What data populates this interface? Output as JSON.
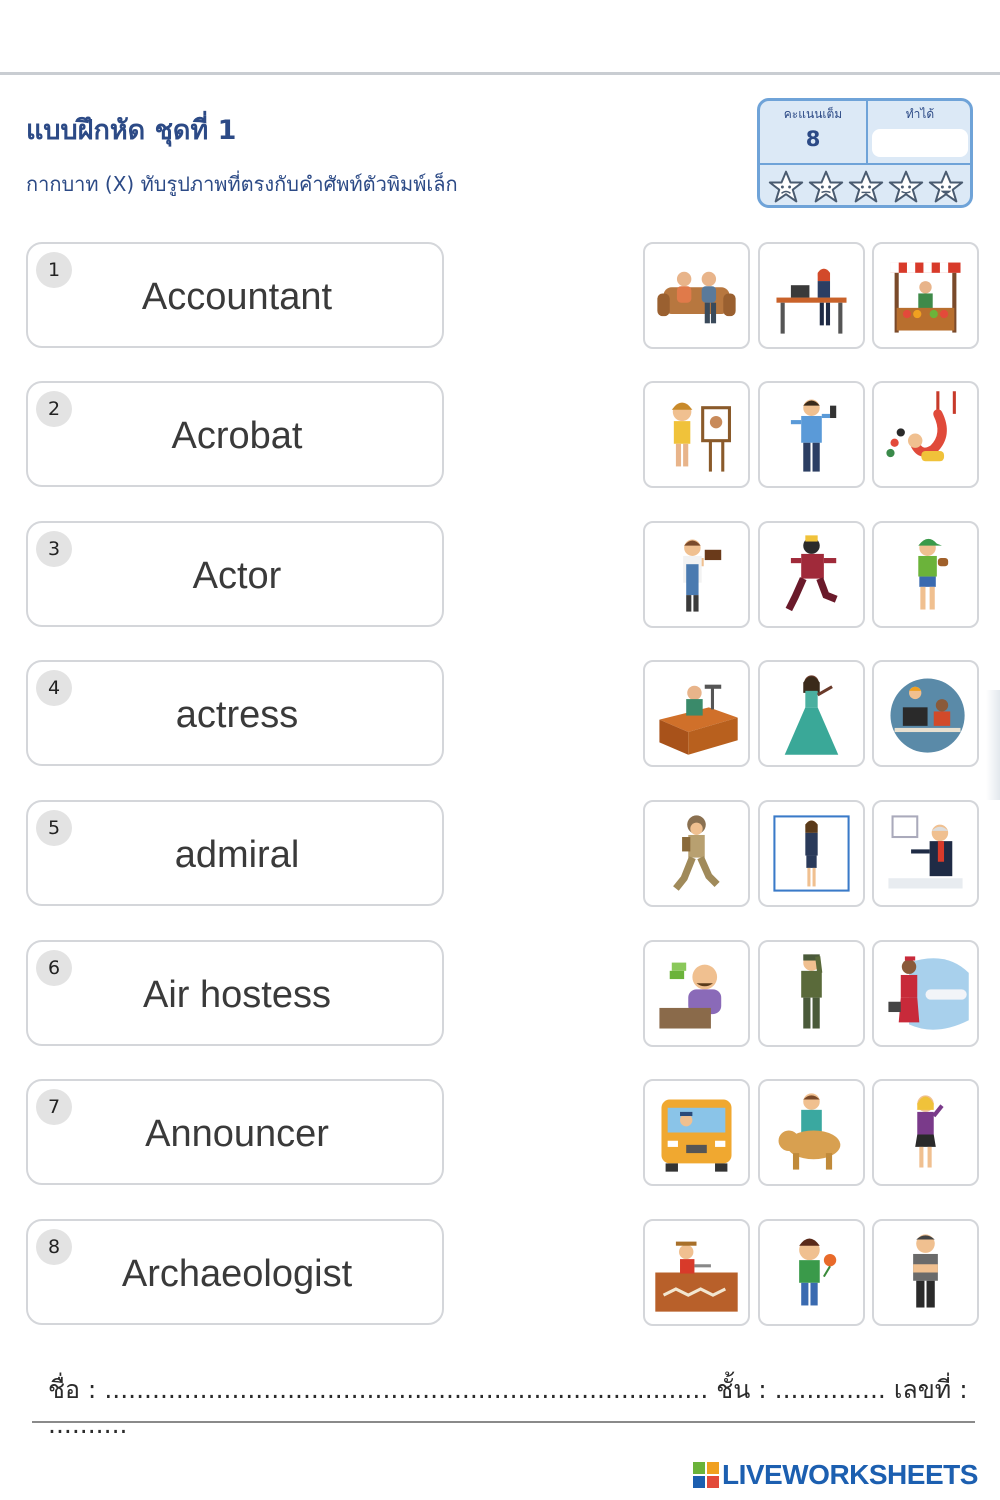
{
  "header": {
    "title": "แบบฝึกหัด ชุดที่ 1",
    "subtitle": "กากบาท (X) ทับรูปภาพที่ตรงกับคำศัพท์ตัวพิมพ์เล็ก"
  },
  "score": {
    "full_label": "คะแนนเต็ม",
    "full_value": "8",
    "got_label": "ทำได้",
    "stars_count": 5
  },
  "items": [
    {
      "number": "1",
      "word": "Accountant",
      "images": [
        "people-on-sofa-icon",
        "woman-at-desk-icon",
        "market-stall-icon"
      ]
    },
    {
      "number": "2",
      "word": "Acrobat",
      "images": [
        "girl-painter-icon",
        "man-with-phone-icon",
        "acrobat-juggler-icon"
      ]
    },
    {
      "number": "3",
      "word": "Actor",
      "images": [
        "baker-with-cake-icon",
        "actor-kneeling-icon",
        "boy-in-cap-icon"
      ]
    },
    {
      "number": "4",
      "word": "actress",
      "images": [
        "man-at-workbench-icon",
        "actress-in-gown-icon",
        "office-workers-icon"
      ]
    },
    {
      "number": "5",
      "word": "admiral",
      "images": [
        "explorer-walking-icon",
        "businesswoman-icon",
        "teacher-presenting-icon"
      ]
    },
    {
      "number": "6",
      "word": "Air hostess",
      "images": [
        "cashier-with-money-icon",
        "soldier-saluting-icon",
        "air-hostess-plane-icon"
      ]
    },
    {
      "number": "7",
      "word": "Announcer",
      "images": [
        "bus-driver-icon",
        "vet-with-dog-icon",
        "woman-announcer-icon"
      ]
    },
    {
      "number": "8",
      "word": "Archaeologist",
      "images": [
        "archaeologist-digging-icon",
        "boy-with-flower-icon",
        "man-arms-crossed-icon"
      ]
    }
  ],
  "footer": {
    "name_label": "ชื่อ :",
    "name_dots": "............................................................................",
    "class_label": "ชั้น :",
    "class_dots": "..............",
    "number_label": "เลขที่ :",
    "number_dots": ".........."
  },
  "brand": {
    "name": "LIVEWORKSHEETS",
    "color": "#1c5fb0"
  },
  "colors": {
    "title": "#2c4a86",
    "score_border": "#6fa3d8",
    "score_fill": "#dce9f6",
    "card_border": "#d4d6da"
  }
}
